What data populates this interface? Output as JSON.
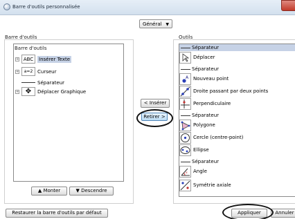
{
  "window": {
    "title": "Barre d'outils personnalisée"
  },
  "general_dropdown": {
    "value": "Général"
  },
  "left_panel": {
    "group_label": "Barre d'outils",
    "tree_label": "Barre d'outils",
    "rows": [
      {
        "icon_text": "ABC",
        "label": "Insérer Texte",
        "selected": true
      },
      {
        "icon_text": "a=2",
        "label": "Curseur"
      },
      {
        "label": "Séparateur",
        "separator": true
      },
      {
        "icon_text": "✥",
        "label": "Déplacer Graphique"
      }
    ],
    "move_up": "▲ Monter",
    "move_down": "▼ Descendre"
  },
  "middle": {
    "insert_button": "< Insérer",
    "remove_button": "Retirer >"
  },
  "right_panel": {
    "group_label": "Outils",
    "rows": [
      {
        "label": "Séparateur",
        "separator": true,
        "selected": true
      },
      {
        "label": "Déplacer"
      },
      {
        "label": "Séparateur",
        "separator": true
      },
      {
        "label": "Nouveau point"
      },
      {
        "label": "Droite passant par deux points"
      },
      {
        "label": "Perpendiculaire"
      },
      {
        "label": "Séparateur",
        "separator": true
      },
      {
        "label": "Polygone"
      },
      {
        "label": "Cercle (centre-point)"
      },
      {
        "label": "Ellipse"
      },
      {
        "label": "Séparateur",
        "separator": true
      },
      {
        "label": "Angle"
      },
      {
        "label": "Symétrie axiale"
      }
    ]
  },
  "footer": {
    "restore_button": "Restaurer la barre d'outils par défaut",
    "apply_button": "Appliquer",
    "cancel_button": "Annuler"
  },
  "colors": {
    "selection": "#c6d2e6",
    "button_highlight": "#bcdcf4"
  },
  "icons": [
    "text-tool-icon",
    "slider-tool-icon",
    "move-graphics-icon",
    "move-arrow-icon",
    "point-icon",
    "line-icon",
    "perpendicular-icon",
    "polygon-icon",
    "circle-icon",
    "ellipse-icon",
    "angle-icon",
    "reflect-icon"
  ]
}
